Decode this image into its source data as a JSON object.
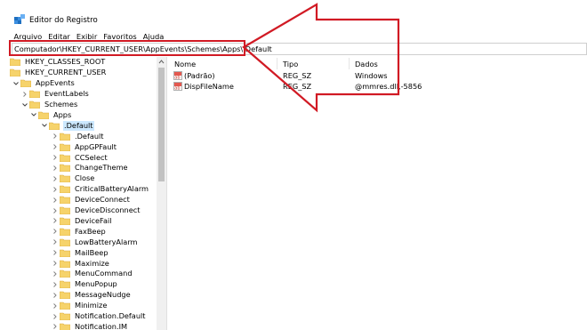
{
  "window": {
    "title": "Editor do Registro",
    "icon": "registry-editor-icon"
  },
  "menu": [
    "Arquivo",
    "Editar",
    "Exibir",
    "Favoritos",
    "Ajuda"
  ],
  "address": {
    "path": "Computador\\HKEY_CURRENT_USER\\AppEvents\\Schemes\\Apps\\.Default"
  },
  "tree": [
    {
      "label": "HKEY_CLASSES_ROOT",
      "depth": 0,
      "chevron": "none",
      "selected": false
    },
    {
      "label": "HKEY_CURRENT_USER",
      "depth": 0,
      "chevron": "none",
      "selected": false
    },
    {
      "label": "AppEvents",
      "depth": 1,
      "chevron": "down",
      "selected": false
    },
    {
      "label": "EventLabels",
      "depth": 2,
      "chevron": "right",
      "selected": false
    },
    {
      "label": "Schemes",
      "depth": 2,
      "chevron": "down",
      "selected": false
    },
    {
      "label": "Apps",
      "depth": 3,
      "chevron": "down",
      "selected": false
    },
    {
      "label": ".Default",
      "depth": 4,
      "chevron": "down",
      "selected": true
    },
    {
      "label": ".Default",
      "depth": 5,
      "chevron": "right",
      "selected": false
    },
    {
      "label": "AppGPFault",
      "depth": 5,
      "chevron": "right",
      "selected": false
    },
    {
      "label": "CCSelect",
      "depth": 5,
      "chevron": "right",
      "selected": false
    },
    {
      "label": "ChangeTheme",
      "depth": 5,
      "chevron": "right",
      "selected": false
    },
    {
      "label": "Close",
      "depth": 5,
      "chevron": "right",
      "selected": false
    },
    {
      "label": "CriticalBatteryAlarm",
      "depth": 5,
      "chevron": "right",
      "selected": false
    },
    {
      "label": "DeviceConnect",
      "depth": 5,
      "chevron": "right",
      "selected": false
    },
    {
      "label": "DeviceDisconnect",
      "depth": 5,
      "chevron": "right",
      "selected": false
    },
    {
      "label": "DeviceFail",
      "depth": 5,
      "chevron": "right",
      "selected": false
    },
    {
      "label": "FaxBeep",
      "depth": 5,
      "chevron": "right",
      "selected": false
    },
    {
      "label": "LowBatteryAlarm",
      "depth": 5,
      "chevron": "right",
      "selected": false
    },
    {
      "label": "MailBeep",
      "depth": 5,
      "chevron": "right",
      "selected": false
    },
    {
      "label": "Maximize",
      "depth": 5,
      "chevron": "right",
      "selected": false
    },
    {
      "label": "MenuCommand",
      "depth": 5,
      "chevron": "right",
      "selected": false
    },
    {
      "label": "MenuPopup",
      "depth": 5,
      "chevron": "right",
      "selected": false
    },
    {
      "label": "MessageNudge",
      "depth": 5,
      "chevron": "right",
      "selected": false
    },
    {
      "label": "Minimize",
      "depth": 5,
      "chevron": "right",
      "selected": false
    },
    {
      "label": "Notification.Default",
      "depth": 5,
      "chevron": "right",
      "selected": false
    },
    {
      "label": "Notification.IM",
      "depth": 5,
      "chevron": "right",
      "selected": false
    }
  ],
  "values": {
    "columns": {
      "name": "Nome",
      "type": "Tipo",
      "data": "Dados"
    },
    "rows": [
      {
        "name": "(Padrão)",
        "type": "REG_SZ",
        "data": "Windows"
      },
      {
        "name": "DispFileName",
        "type": "REG_SZ",
        "data": "@mmres.dll,-5856"
      }
    ]
  },
  "colors": {
    "annotation_red": "#d11a24",
    "selection": "#cce8ff",
    "folder": "#f6d36b"
  }
}
